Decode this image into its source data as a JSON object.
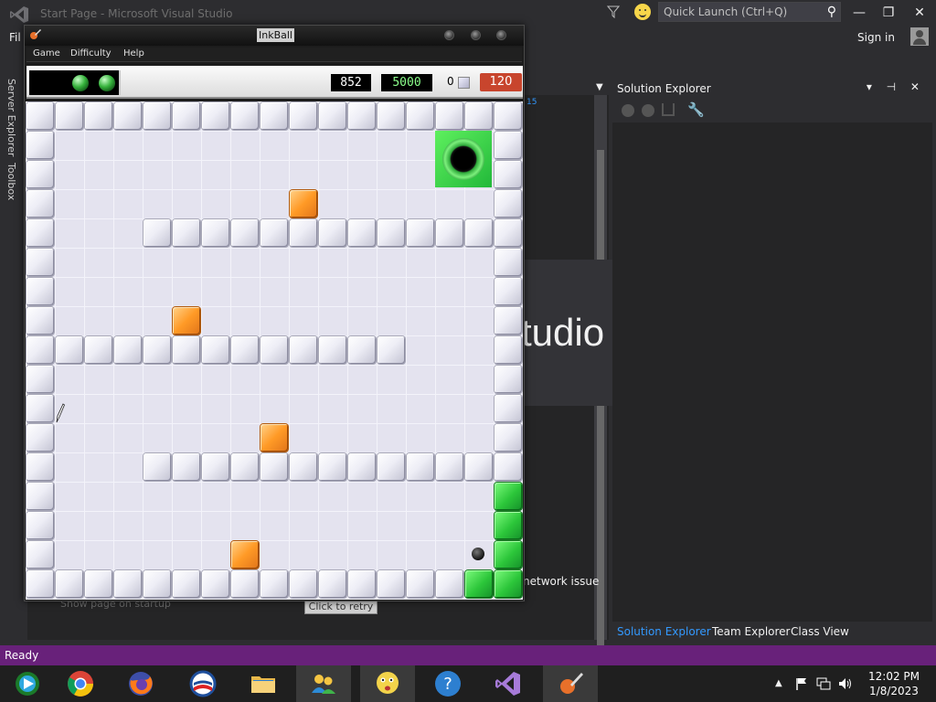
{
  "vs": {
    "title": "Start Page - Microsoft Visual Studio",
    "quick_launch_placeholder": "Quick Launch (Ctrl+Q)",
    "menu_fragment": "Fil",
    "sign_in": "Sign in",
    "side_tabs": [
      "Server Explorer",
      "Toolbox"
    ],
    "doc_link_fragment": "15",
    "splash_fragment": "tudio",
    "network_message_fragment": "network issue",
    "retry_button": "Click to retry",
    "show_page_on_startup": "Show page on startup",
    "status_text": "Ready",
    "accent_color": "#68217a"
  },
  "solution_explorer": {
    "title": "Solution Explorer",
    "header_icons": "▾ ⊣ ✕",
    "tabs": [
      {
        "label": "Solution Explorer",
        "active": true
      },
      {
        "label": "Team Explorer",
        "active": false
      },
      {
        "label": "Class View",
        "active": false
      }
    ]
  },
  "inkball": {
    "window_title": "InkBall",
    "menu": [
      "Game",
      "Difficulty",
      "Help"
    ],
    "queued_balls": 2,
    "score": "852",
    "target_score": "5000",
    "missed_count": "0",
    "time_remaining": "120",
    "ball_color": "green",
    "timer_color": "#c8452d"
  },
  "taskbar": {
    "apps": [
      {
        "name": "windows-media-center",
        "icon": "media-center-icon"
      },
      {
        "name": "google-chrome",
        "icon": "chrome-icon"
      },
      {
        "name": "firefox",
        "icon": "firefox-icon"
      },
      {
        "name": "browser",
        "icon": "obama-logo-icon"
      },
      {
        "name": "file-explorer",
        "icon": "folder-icon"
      },
      {
        "name": "people",
        "icon": "people-icon"
      },
      {
        "name": "chat",
        "icon": "balloon-face-icon"
      },
      {
        "name": "help",
        "icon": "help-icon"
      },
      {
        "name": "visual-studio",
        "icon": "visual-studio-icon"
      },
      {
        "name": "inkball",
        "icon": "inkball-icon",
        "active": true
      }
    ],
    "time": "12:02 PM",
    "date": "1/8/2023"
  }
}
